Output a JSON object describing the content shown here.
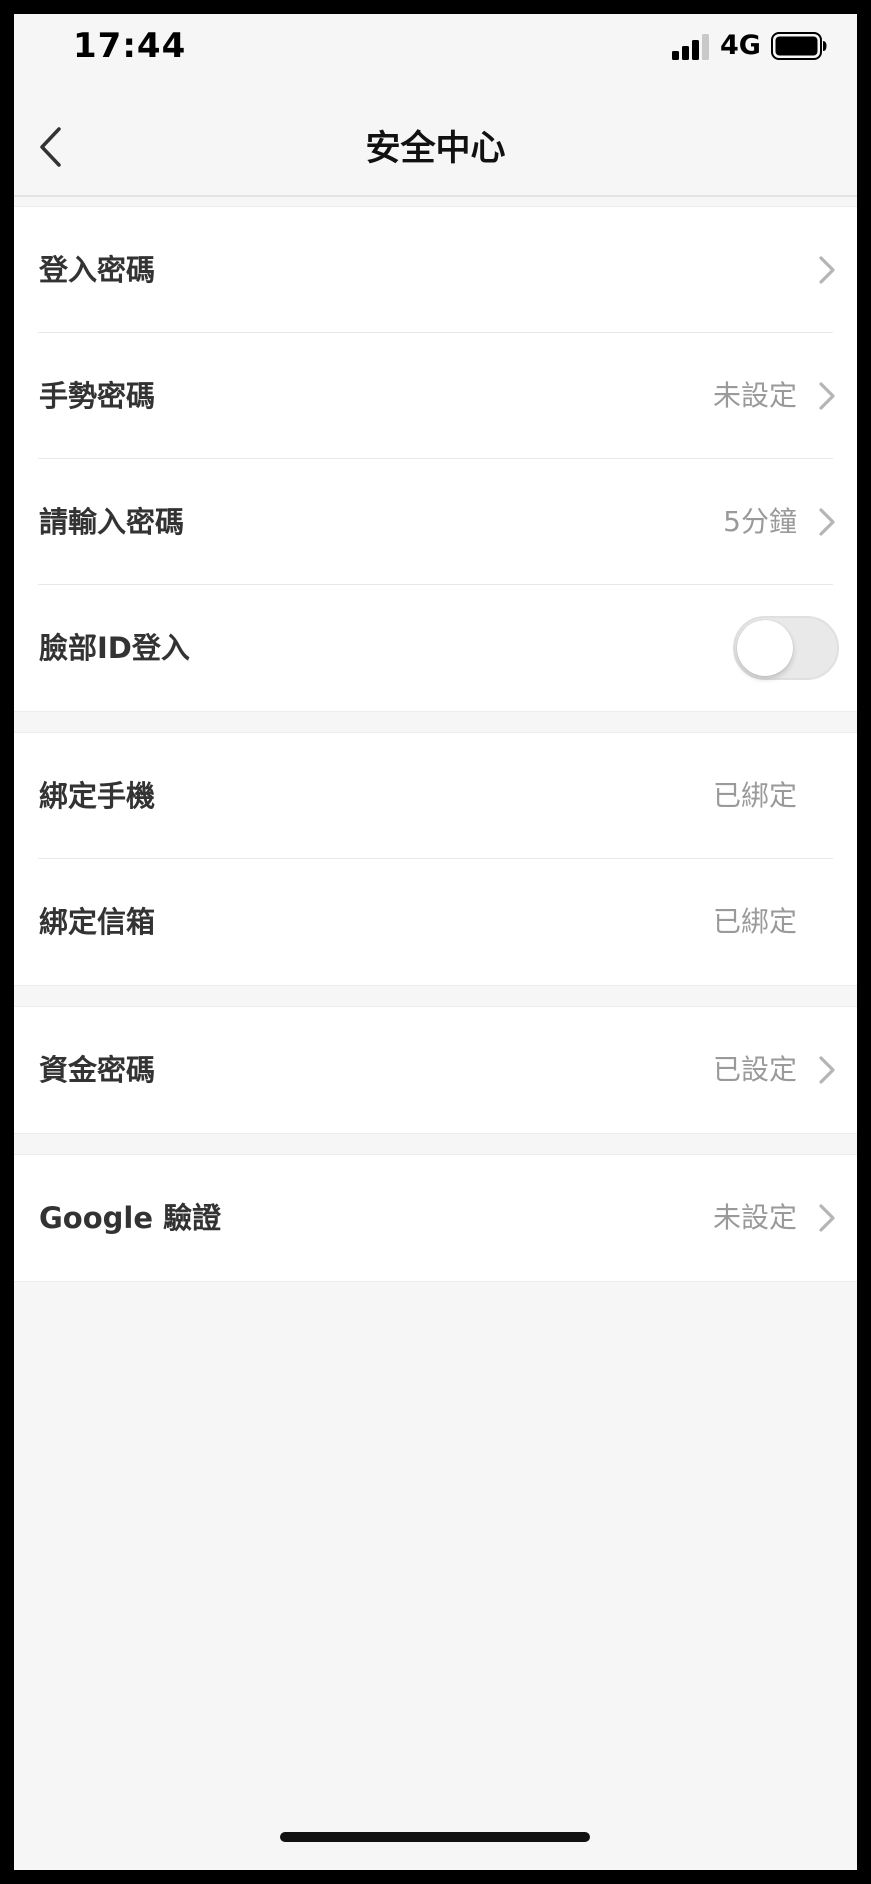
{
  "status_bar": {
    "time": "17:44",
    "network": "4G",
    "signal_icon": "cellular-signal-icon",
    "battery_icon": "battery-full-icon"
  },
  "nav": {
    "title": "安全中心",
    "back_icon": "chevron-left-icon"
  },
  "groups": [
    {
      "rows": [
        {
          "label": "登入密碼",
          "value": "",
          "chevron": true
        },
        {
          "label": "手勢密碼",
          "value": "未設定",
          "chevron": true
        },
        {
          "label": "請輸入密碼",
          "value": "5分鐘",
          "chevron": true
        },
        {
          "label": "臉部ID登入",
          "toggle": false
        }
      ]
    },
    {
      "rows": [
        {
          "label": "綁定手機",
          "value": "已綁定",
          "chevron": false
        },
        {
          "label": "綁定信箱",
          "value": "已綁定",
          "chevron": false
        }
      ]
    },
    {
      "rows": [
        {
          "label": "資金密碼",
          "value": "已設定",
          "chevron": true
        }
      ]
    },
    {
      "rows": [
        {
          "label": "Google 驗證",
          "value": "未設定",
          "chevron": true
        }
      ]
    }
  ],
  "colors": {
    "background": "#f6f6f6",
    "card": "#ffffff",
    "label": "#333333",
    "value": "#9a9a9a",
    "chevron": "#b5b5b5"
  }
}
